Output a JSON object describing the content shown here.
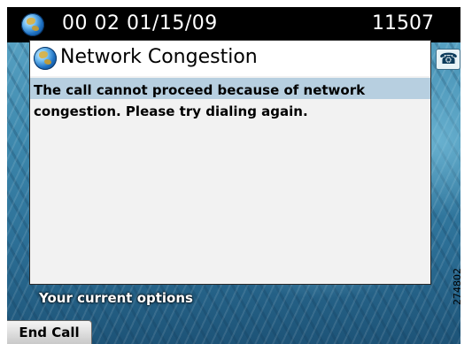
{
  "status_bar": {
    "datetime": "00 02 01/15/09",
    "extension": "11507",
    "status_icon": "globe-icon"
  },
  "line_button": {
    "icon": "phone-icon"
  },
  "dialog": {
    "title": "Network Congestion",
    "title_icon": "globe-icon",
    "message": "The call cannot proceed because of network congestion. Please try dialing again."
  },
  "options": {
    "label": "Your current options"
  },
  "softkeys": [
    {
      "label": "End Call"
    }
  ],
  "figure_id": "274802",
  "colors": {
    "header_background": "#000000",
    "dialog_background": "#f2f2f2",
    "message_highlight": "#b7cfe0"
  }
}
